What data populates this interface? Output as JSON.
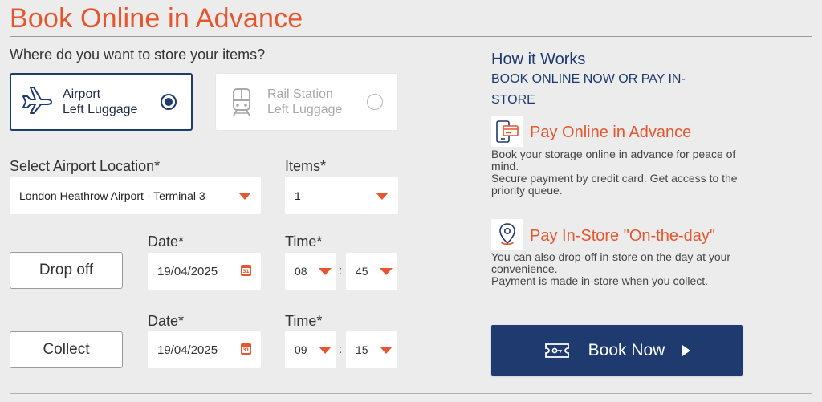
{
  "header": {
    "title": "Book Online in Advance"
  },
  "storage": {
    "question": "Where do you want to store your items?",
    "options": [
      {
        "line1": "Airport",
        "line2": "Left Luggage",
        "icon": "airplane-icon",
        "selected": true
      },
      {
        "line1": "Rail Station",
        "line2": "Left Luggage",
        "icon": "train-icon",
        "selected": false
      }
    ]
  },
  "location": {
    "label": "Select Airport Location*",
    "value": "London Heathrow Airport - Terminal 3"
  },
  "items": {
    "label": "Items*",
    "value": "1"
  },
  "dropoff": {
    "button_label": "Drop off",
    "date_label": "Date*",
    "date_value": "19/04/2025",
    "time_label": "Time*",
    "hour": "08",
    "minute": "45",
    "separator": ":"
  },
  "collect": {
    "button_label": "Collect",
    "date_label": "Date*",
    "date_value": "19/04/2025",
    "time_label": "Time*",
    "hour": "09",
    "minute": "15",
    "separator": ":"
  },
  "calendar_icon_day": "31",
  "how": {
    "title": "How it Works",
    "subtitle": "BOOK ONLINE NOW OR PAY IN-STORE",
    "features": [
      {
        "icon": "card-payment-icon",
        "title": "Pay Online in Advance",
        "line1": "Book your storage online in advance for peace of mind.",
        "line2": "Secure payment by credit card. Get access to the priority queue."
      },
      {
        "icon": "location-pin-icon",
        "title": "Pay In-Store \"On-the-day\"",
        "line1": "You can also drop-off in-store on the day at your convenience.",
        "line2": "Payment is made in-store when you collect."
      }
    ]
  },
  "book_button": {
    "label": "Book Now",
    "icon": "ticket-icon",
    "arrow_icon": "play-arrow-icon"
  },
  "colors": {
    "accent": "#e4572e",
    "navy": "#1e3a6e",
    "background": "#ececec"
  }
}
